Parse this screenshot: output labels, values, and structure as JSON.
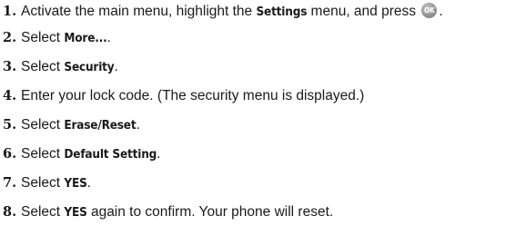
{
  "steps": [
    {
      "number": "1.",
      "pre": "Activate the main menu, highlight the ",
      "bold": "Settings",
      "post": " menu, and press ",
      "ok_icon_label": "OK",
      "tail": "."
    },
    {
      "number": "2.",
      "pre": "Select ",
      "bold": "More...",
      "post": "."
    },
    {
      "number": "3.",
      "pre": "Select ",
      "bold": "Security",
      "post": "."
    },
    {
      "number": "4.",
      "text": "Enter your lock code. (The security menu is displayed.)"
    },
    {
      "number": "5.",
      "pre": "Select ",
      "bold": "Erase/Reset",
      "post": "."
    },
    {
      "number": "6.",
      "pre": "Select ",
      "bold": "Default Setting",
      "post": "."
    },
    {
      "number": "7.",
      "pre": "Select ",
      "bold": "YES",
      "post": "."
    },
    {
      "number": "8.",
      "pre": "Select ",
      "bold": "YES",
      "post": " again to confirm. Your phone will reset."
    }
  ]
}
